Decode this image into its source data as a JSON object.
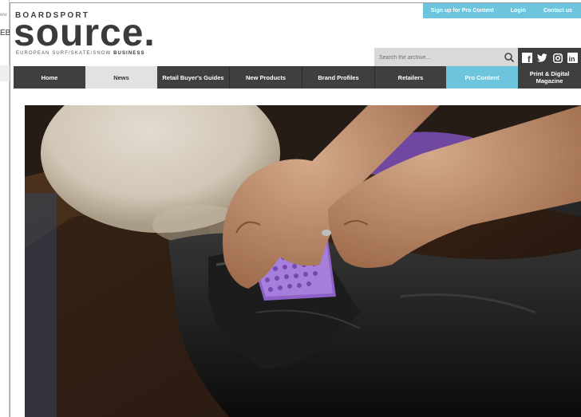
{
  "background_window": {
    "url_fragment": "ww",
    "text_fragment": "EBS"
  },
  "logo": {
    "top_text": "BOARDSPORT",
    "main_text": "source.",
    "sub_text": "EUROPEAN SURF/SKATE/SNOW",
    "sub_bold": "BUSINESS"
  },
  "topbar": {
    "signup": "Sign up for Pro Content",
    "login": "Login",
    "contact": "Contact us"
  },
  "search": {
    "placeholder": "Search the archive..."
  },
  "social": {
    "facebook": "f",
    "linkedin": "in"
  },
  "nav": {
    "home": "Home",
    "news": "News",
    "guides": "Retail Buyer's Guides",
    "products": "New Products",
    "brands": "Brand Profiles",
    "retailers": "Retailers",
    "pro": "Pro Content",
    "print_line1": "Print & Digital",
    "print_line2": "Magazine"
  },
  "colors": {
    "accent": "#6cc5dd",
    "nav_dark": "#3f3f3f",
    "nav_active": "#e2e2e2",
    "logo": "#3b3b3b"
  }
}
